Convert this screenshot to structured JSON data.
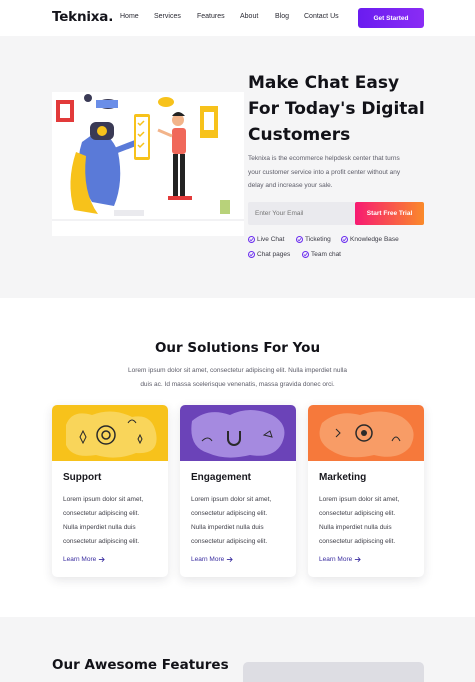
{
  "brand": {
    "logo": "Teknixa."
  },
  "nav": {
    "links": [
      "Home",
      "Services",
      "Features",
      "About",
      "Blog",
      "Contact Us"
    ],
    "cta": "Get Started"
  },
  "hero": {
    "title_lines": [
      "Make Chat Easy",
      "For Today's Digital",
      "Customers"
    ],
    "description_lines": [
      "Teknixa is the ecommerce helpdesk center that turns",
      "your customer service into a profit center without any",
      "delay and increase your sale."
    ],
    "email_placeholder": "Enter Your Email",
    "trial_button": "Start Free Trial",
    "features": [
      "Live Chat",
      "Ticketing",
      "Knowledge Base",
      "Chat pages",
      "Team chat"
    ]
  },
  "solutions": {
    "title": "Our Solutions For You",
    "subtitle_lines": [
      "Lorem ipsum dolor sit amet, consectetur adipiscing elit. Nulla imperdiet nulla",
      "duis ac. Id massa scelerisque venenatis, massa gravida donec orci."
    ],
    "cards": [
      {
        "title": "Support",
        "text_lines": [
          "Lorem ipsum dolor sit amet,",
          "consectetur adipiscing elit.",
          "Nulla imperdiet nulla duis",
          "consectetur adipiscing elit."
        ],
        "link": "Learn More",
        "color": "#f7c21b"
      },
      {
        "title": "Engagement",
        "text_lines": [
          "Lorem ipsum dolor sit amet,",
          "consectetur adipiscing elit.",
          "Nulla imperdiet nulla duis",
          "consectetur adipiscing elit."
        ],
        "link": "Learn More",
        "color": "#7c55cc"
      },
      {
        "title": "Marketing",
        "text_lines": [
          "Lorem ipsum dolor sit amet,",
          "consectetur adipiscing elit.",
          "Nulla imperdiet nulla duis",
          "consectetur adipiscing elit."
        ],
        "link": "Learn More",
        "color": "#f6793b"
      }
    ]
  },
  "features_section": {
    "title": "Our Awesome Features"
  },
  "colors": {
    "accent": "#6a1cf0",
    "trial_start": "#f71a72",
    "trial_end": "#fa8a2a"
  }
}
